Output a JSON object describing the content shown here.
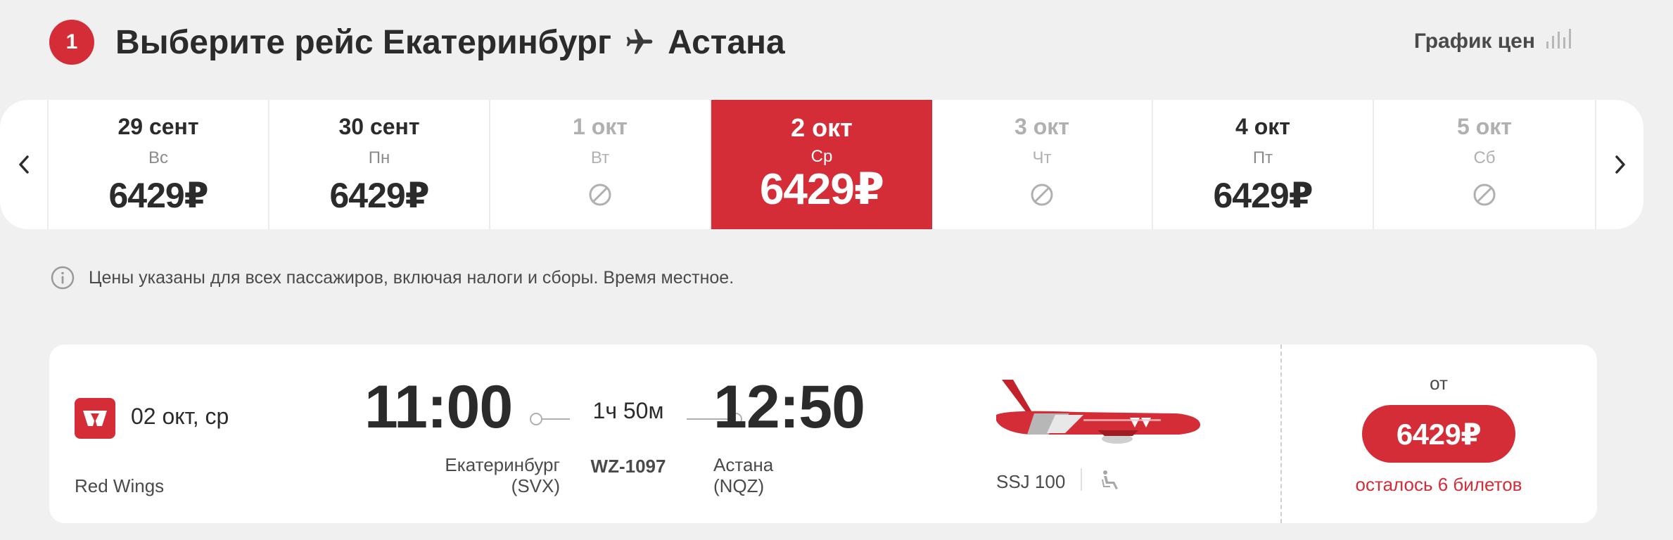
{
  "header": {
    "step_number": "1",
    "title_prefix": "Выберите рейс Екатеринбург",
    "title_destination": "Астана",
    "price_graph_label": "График цен"
  },
  "dates": [
    {
      "date": "29 сент",
      "dow": "Вс",
      "price": "6429₽",
      "available": true,
      "selected": false
    },
    {
      "date": "30 сент",
      "dow": "Пн",
      "price": "6429₽",
      "available": true,
      "selected": false
    },
    {
      "date": "1 окт",
      "dow": "Вт",
      "price": "",
      "available": false,
      "selected": false
    },
    {
      "date": "2 окт",
      "dow": "Ср",
      "price": "6429₽",
      "available": true,
      "selected": true
    },
    {
      "date": "3 окт",
      "dow": "Чт",
      "price": "",
      "available": false,
      "selected": false
    },
    {
      "date": "4 окт",
      "dow": "Пт",
      "price": "6429₽",
      "available": true,
      "selected": false
    },
    {
      "date": "5 окт",
      "dow": "Сб",
      "price": "",
      "available": false,
      "selected": false
    }
  ],
  "info": {
    "text": "Цены указаны для всех пассажиров, включая налоги и сборы. Время местное."
  },
  "flight": {
    "date": "02 окт, ср",
    "airline": "Red Wings",
    "departure_time": "11:00",
    "departure_city": "Екатеринбург",
    "departure_code": "(SVX)",
    "duration": "1ч 50м",
    "flight_number": "WZ-1097",
    "arrival_time": "12:50",
    "arrival_city": "Астана",
    "arrival_code": "(NQZ)",
    "aircraft": "SSJ 100",
    "price_from": "от",
    "price": "6429₽",
    "tickets_left": "осталось 6 билетов"
  },
  "colors": {
    "accent": "#d42d37",
    "background": "#f0f0f1",
    "text": "#2b2b2b"
  }
}
